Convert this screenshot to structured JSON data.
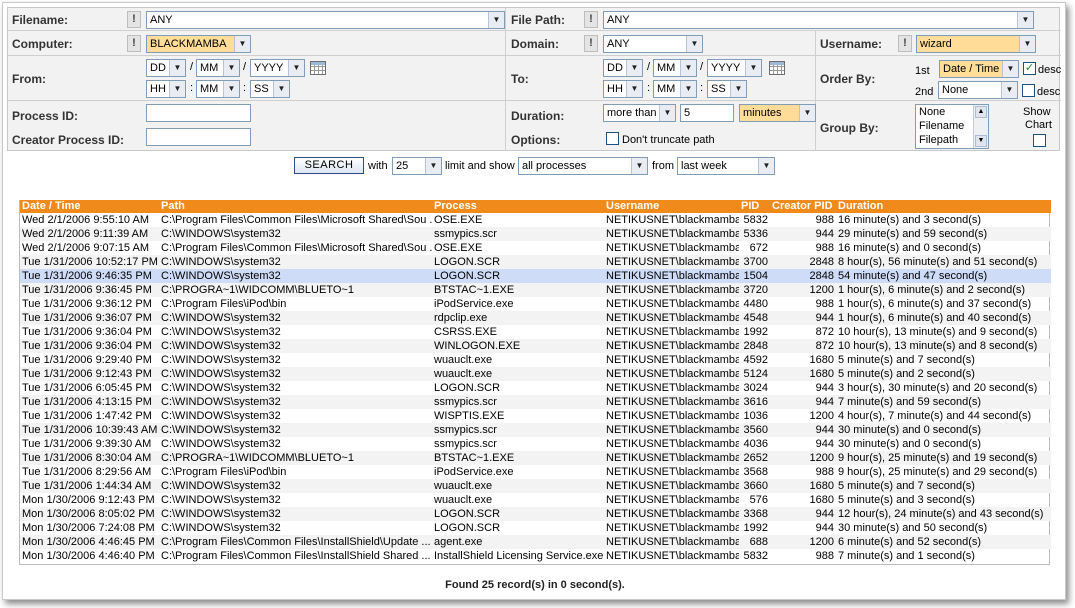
{
  "filters": {
    "filename": {
      "label": "Filename:",
      "value": "ANY"
    },
    "file_path": {
      "label": "File Path:",
      "value": "ANY"
    },
    "computer": {
      "label": "Computer:",
      "value": "BLACKMAMBA"
    },
    "domain": {
      "label": "Domain:",
      "value": "ANY"
    },
    "username": {
      "label": "Username:",
      "value": "wizard"
    },
    "lock_symbol": "!",
    "from": {
      "label": "From:",
      "date": [
        "DD",
        "MM",
        "YYYY"
      ],
      "time": [
        "HH",
        "MM",
        "SS"
      ]
    },
    "to": {
      "label": "To:",
      "date": [
        "DD",
        "MM",
        "YYYY"
      ],
      "time": [
        "HH",
        "MM",
        "SS"
      ]
    },
    "date_sep": "/",
    "time_sep": ":",
    "order_by": {
      "label": "Order By:",
      "first_label": "1st",
      "first_value": "Date / Time",
      "first_desc_checked": true,
      "second_label": "2nd",
      "second_value": "None",
      "second_desc_checked": false,
      "desc_label": "desc"
    },
    "process_id": {
      "label": "Process ID:",
      "value": ""
    },
    "creator_process_id": {
      "label": "Creator Process ID:",
      "value": ""
    },
    "duration": {
      "label": "Duration:",
      "comparator": "more than",
      "amount": "5",
      "unit": "minutes"
    },
    "options": {
      "label": "Options:",
      "dont_truncate_label": "Don't truncate path",
      "checked": false
    },
    "group_by": {
      "label": "Group By:",
      "options": [
        "None",
        "Filename",
        "Filepath"
      ]
    },
    "show_chart": {
      "label_line1": "Show",
      "label_line2": "Chart",
      "checked": false
    }
  },
  "search_bar": {
    "button_label": "SEARCH",
    "with_label": "with",
    "limit_value": "25",
    "limit_label": "limit and show",
    "scope_value": "all processes",
    "from_label": "from",
    "period_value": "last week"
  },
  "table": {
    "columns": [
      "Date / Time",
      "Path",
      "Process",
      "Username",
      "PID",
      "Creator PID",
      "Duration"
    ],
    "selected_row": 4,
    "rows": [
      [
        "Wed 2/1/2006 9:55:10 AM",
        "C:\\Program Files\\Common Files\\Microsoft Shared\\Sou ...",
        "OSE.EXE",
        "NETIKUSNET\\blackmamba$",
        "5832",
        "988",
        "16 minute(s) and 3 second(s)"
      ],
      [
        "Wed 2/1/2006 9:11:39 AM",
        "C:\\WINDOWS\\system32",
        "ssmypics.scr",
        "NETIKUSNET\\blackmamba$",
        "5336",
        "944",
        "29 minute(s) and 59 second(s)"
      ],
      [
        "Wed 2/1/2006 9:07:15 AM",
        "C:\\Program Files\\Common Files\\Microsoft Shared\\Sou ...",
        "OSE.EXE",
        "NETIKUSNET\\blackmamba$",
        "672",
        "988",
        "16 minute(s) and 0 second(s)"
      ],
      [
        "Tue 1/31/2006 10:52:17 PM",
        "C:\\WINDOWS\\system32",
        "LOGON.SCR",
        "NETIKUSNET\\blackmamba$",
        "3700",
        "2848",
        "8 hour(s), 56 minute(s) and 51 second(s)"
      ],
      [
        "Tue 1/31/2006 9:46:35 PM",
        "C:\\WINDOWS\\system32",
        "LOGON.SCR",
        "NETIKUSNET\\blackmamba$",
        "1504",
        "2848",
        "54 minute(s) and 47 second(s)"
      ],
      [
        "Tue 1/31/2006 9:36:45 PM",
        "C:\\PROGRA~1\\WIDCOMM\\BLUETO~1",
        "BTSTAC~1.EXE",
        "NETIKUSNET\\blackmamba$",
        "3720",
        "1200",
        "1 hour(s), 6 minute(s) and 2 second(s)"
      ],
      [
        "Tue 1/31/2006 9:36:12 PM",
        "C:\\Program Files\\iPod\\bin",
        "iPodService.exe",
        "NETIKUSNET\\blackmamba$",
        "4480",
        "988",
        "1 hour(s), 6 minute(s) and 37 second(s)"
      ],
      [
        "Tue 1/31/2006 9:36:07 PM",
        "C:\\WINDOWS\\system32",
        "rdpclip.exe",
        "NETIKUSNET\\blackmamba$",
        "4548",
        "944",
        "1 hour(s), 6 minute(s) and 40 second(s)"
      ],
      [
        "Tue 1/31/2006 9:36:04 PM",
        "C:\\WINDOWS\\system32",
        "CSRSS.EXE",
        "NETIKUSNET\\blackmamba$",
        "1992",
        "872",
        "10 hour(s), 13 minute(s) and 9 second(s)"
      ],
      [
        "Tue 1/31/2006 9:36:04 PM",
        "C:\\WINDOWS\\system32",
        "WINLOGON.EXE",
        "NETIKUSNET\\blackmamba$",
        "2848",
        "872",
        "10 hour(s), 13 minute(s) and 8 second(s)"
      ],
      [
        "Tue 1/31/2006 9:29:40 PM",
        "C:\\WINDOWS\\system32",
        "wuauclt.exe",
        "NETIKUSNET\\blackmamba$",
        "4592",
        "1680",
        "5 minute(s) and 7 second(s)"
      ],
      [
        "Tue 1/31/2006 9:12:43 PM",
        "C:\\WINDOWS\\system32",
        "wuauclt.exe",
        "NETIKUSNET\\blackmamba$",
        "5124",
        "1680",
        "5 minute(s) and 2 second(s)"
      ],
      [
        "Tue 1/31/2006 6:05:45 PM",
        "C:\\WINDOWS\\system32",
        "LOGON.SCR",
        "NETIKUSNET\\blackmamba$",
        "3024",
        "944",
        "3 hour(s), 30 minute(s) and 20 second(s)"
      ],
      [
        "Tue 1/31/2006 4:13:15 PM",
        "C:\\WINDOWS\\system32",
        "ssmypics.scr",
        "NETIKUSNET\\blackmamba$",
        "3616",
        "944",
        "7 minute(s) and 59 second(s)"
      ],
      [
        "Tue 1/31/2006 1:47:42 PM",
        "C:\\WINDOWS\\system32",
        "WISPTIS.EXE",
        "NETIKUSNET\\blackmamba$",
        "1036",
        "1200",
        "4 hour(s), 7 minute(s) and 44 second(s)"
      ],
      [
        "Tue 1/31/2006 10:39:43 AM",
        "C:\\WINDOWS\\system32",
        "ssmypics.scr",
        "NETIKUSNET\\blackmamba$",
        "3560",
        "944",
        "30 minute(s) and 0 second(s)"
      ],
      [
        "Tue 1/31/2006 9:39:30 AM",
        "C:\\WINDOWS\\system32",
        "ssmypics.scr",
        "NETIKUSNET\\blackmamba$",
        "4036",
        "944",
        "30 minute(s) and 0 second(s)"
      ],
      [
        "Tue 1/31/2006 8:30:04 AM",
        "C:\\PROGRA~1\\WIDCOMM\\BLUETO~1",
        "BTSTAC~1.EXE",
        "NETIKUSNET\\blackmamba$",
        "2652",
        "1200",
        "9 hour(s), 25 minute(s) and 19 second(s)"
      ],
      [
        "Tue 1/31/2006 8:29:56 AM",
        "C:\\Program Files\\iPod\\bin",
        "iPodService.exe",
        "NETIKUSNET\\blackmamba$",
        "3568",
        "988",
        "9 hour(s), 25 minute(s) and 29 second(s)"
      ],
      [
        "Tue 1/31/2006 1:44:34 AM",
        "C:\\WINDOWS\\system32",
        "wuauclt.exe",
        "NETIKUSNET\\blackmamba$",
        "3660",
        "1680",
        "5 minute(s) and 7 second(s)"
      ],
      [
        "Mon 1/30/2006 9:12:43 PM",
        "C:\\WINDOWS\\system32",
        "wuauclt.exe",
        "NETIKUSNET\\blackmamba$",
        "576",
        "1680",
        "5 minute(s) and 3 second(s)"
      ],
      [
        "Mon 1/30/2006 8:05:02 PM",
        "C:\\WINDOWS\\system32",
        "LOGON.SCR",
        "NETIKUSNET\\blackmamba$",
        "3368",
        "944",
        "12 hour(s), 24 minute(s) and 43 second(s)"
      ],
      [
        "Mon 1/30/2006 7:24:08 PM",
        "C:\\WINDOWS\\system32",
        "LOGON.SCR",
        "NETIKUSNET\\blackmamba$",
        "1992",
        "944",
        "30 minute(s) and 50 second(s)"
      ],
      [
        "Mon 1/30/2006 4:46:45 PM",
        "C:\\Program Files\\Common Files\\InstallShield\\Update ...",
        "agent.exe",
        "NETIKUSNET\\blackmamba$",
        "688",
        "1200",
        "6 minute(s) and 52 second(s)"
      ],
      [
        "Mon 1/30/2006 4:46:40 PM",
        "C:\\Program Files\\Common Files\\InstallShield Shared ...",
        "InstallShield Licensing Service.exe",
        "NETIKUSNET\\blackmamba$",
        "5832",
        "988",
        "7 minute(s) and 1 second(s)"
      ]
    ]
  },
  "footer": {
    "text": "Found 25 record(s) in 0 second(s)."
  },
  "colors": {
    "header_bg": "#f08a1a",
    "highlight_select": "#ffdd99",
    "selected_row": "#cfdcf7",
    "panel_bg": "#f2f2f2"
  },
  "icons": {
    "dropdown": "chevron-down-icon",
    "calendar": "calendar-icon",
    "lock": "lock-icon"
  }
}
